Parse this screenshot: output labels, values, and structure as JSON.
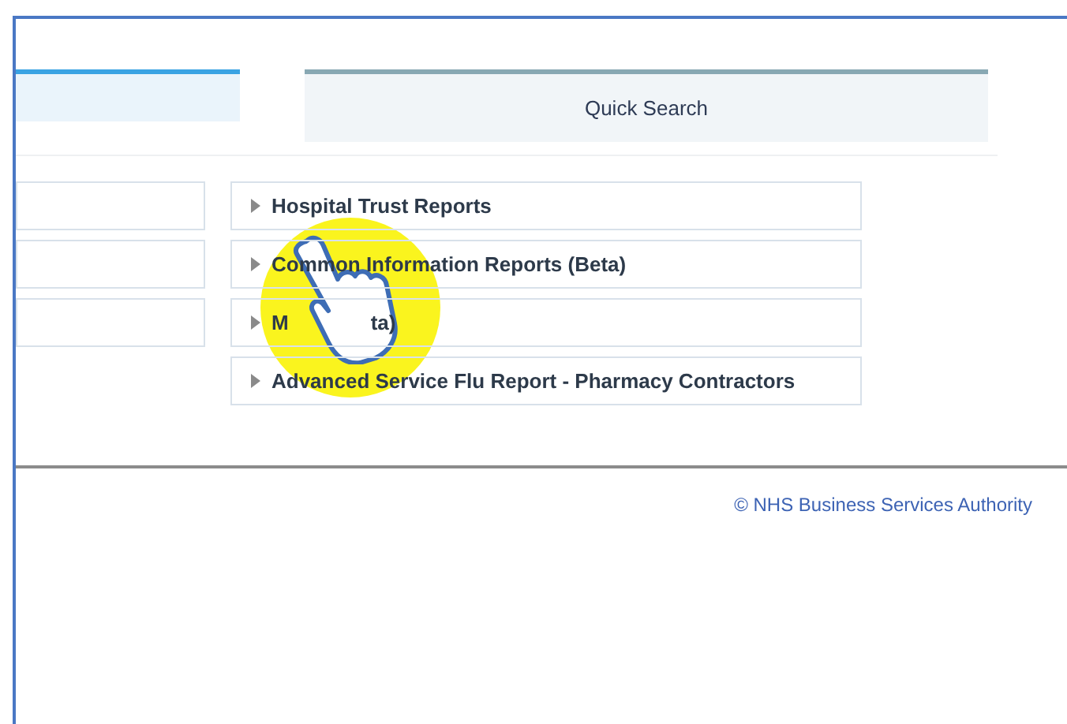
{
  "tabs": [
    {
      "selected": true
    },
    {
      "label": "Quick Search",
      "selected": false
    }
  ],
  "report_links": [
    {
      "fragments": [
        "Hospital Trust Reports"
      ]
    },
    {
      "fragments": [
        "Common Information Reports (Beta)"
      ]
    },
    {
      "fragments": [
        "M",
        "ta)"
      ]
    },
    {
      "fragments": [
        "Advanced Service Flu Report - Pharmacy Contractors"
      ]
    }
  ],
  "footer": {
    "copyright": "© NHS Business Services Authority"
  }
}
